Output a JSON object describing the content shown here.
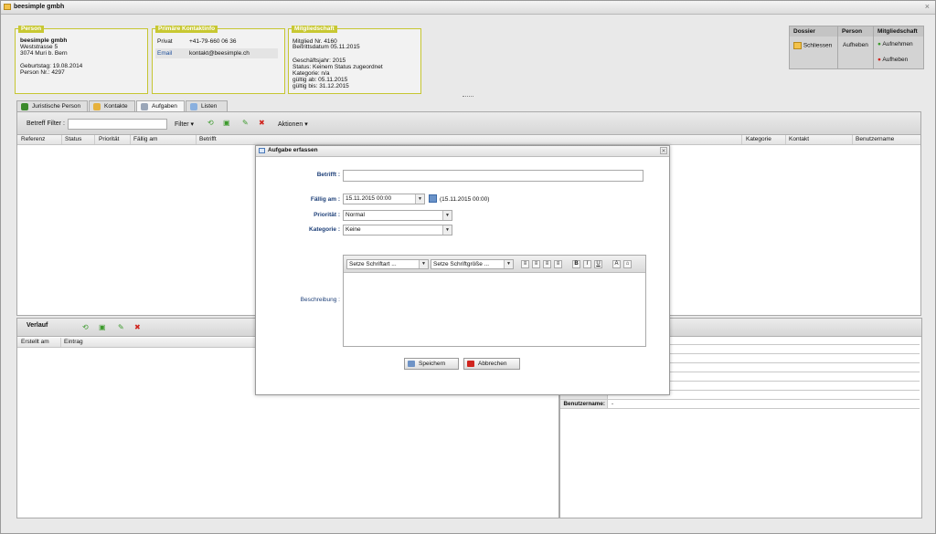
{
  "window": {
    "title": "beesimple gmbh"
  },
  "person_card": {
    "header": "Person",
    "name": "beesimple gmbh",
    "street": "Weststrasse 5",
    "city": "3074 Muri b. Bern",
    "birthday": "Geburtstag: 19.08.2014",
    "person_nr": "Person Nr.: 4297"
  },
  "contact_card": {
    "header": "Primäre Kontaktinfo",
    "rows": [
      {
        "label": "Privat",
        "value": "+41-79-660 06 36"
      },
      {
        "label": "Email",
        "value": "kontakt@beesimple.ch"
      }
    ]
  },
  "membership_card": {
    "header": "Mitgliedschaft",
    "lines": [
      "Mitglied Nr. 4160",
      "Beitrittsdatum 05.11.2015",
      "",
      "Geschäftsjahr: 2015",
      "Status: Keinem Status zugeordnet",
      "Kategorie: n/a",
      "gültig ab: 05.11.2015",
      "gültig bis: 31.12.2015"
    ]
  },
  "actions": {
    "dossier": {
      "header": "Dossier",
      "close": "Schliessen"
    },
    "person": {
      "header": "Person",
      "remove": "Aufheben"
    },
    "membership": {
      "header": "Mitgliedschaft",
      "add": "Aufnehmen",
      "remove": "Aufheben"
    }
  },
  "tabs": [
    "Juristische Person",
    "Kontakte",
    "Aufgaben",
    "Listen"
  ],
  "task_toolbar": {
    "filter_label": "Betreff Filter :",
    "filter_button": "Filter",
    "actions_button": "Aktionen"
  },
  "task_columns": [
    "Referenz",
    "Status",
    "Priorität",
    "Fällig am",
    "Betrifft",
    "Kategorie",
    "Kontakt",
    "Benutzername"
  ],
  "history": {
    "title": "Verlauf",
    "columns": [
      "Erstellt am",
      "Eintrag"
    ]
  },
  "details": {
    "benutzername_label": "Benutzername:",
    "benutzername_value": "-"
  },
  "dialog": {
    "title": "Aufgabe erfassen",
    "betrifft_label": "Betrifft :",
    "faellig_label": "Fällig am :",
    "faellig_value": "15.11.2015 00:00",
    "faellig_hint": "(15.11.2015 00:00)",
    "prioritaet_label": "Priorität :",
    "prioritaet_value": "Normal",
    "kategorie_label": "Kategorie :",
    "kategorie_value": "Keine",
    "beschreibung_label": "Beschreibung :",
    "font_select": "Setze Schriftart ...",
    "size_select": "Setze Schriftgröße ...",
    "save": "Speichern",
    "cancel": "Abbrechen"
  }
}
